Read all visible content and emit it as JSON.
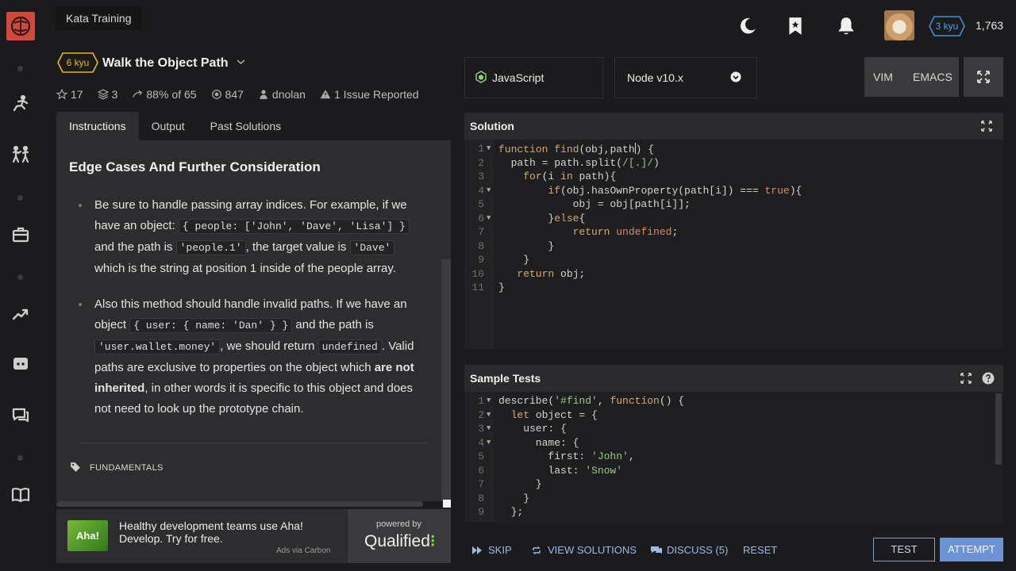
{
  "tooltip": "Kata Training",
  "user": {
    "rank": "3 kyu",
    "honor": "1,763"
  },
  "kata": {
    "rank": "6 kyu",
    "title": "Walk the Object Path",
    "stats": {
      "stars": "17",
      "collections": "3",
      "satisfaction_pct": "88%",
      "satisfaction_of": "of 65",
      "completed": "847",
      "author": "dnolan",
      "issues": "1 Issue Reported"
    }
  },
  "tabs": [
    "Instructions",
    "Output",
    "Past Solutions"
  ],
  "description": {
    "heading": "Edge Cases And Further Consideration",
    "bullet1": {
      "t1": "Be sure to handle passing array indices. For example, if we have an object:",
      "c1": "{ people: ['John', 'Dave', 'Lisa'] }",
      "t2": "and the path is",
      "c2": "'people.1'",
      "t3": ", the target value is",
      "c3": "'Dave'",
      "t4": "which is the string at position 1 inside of the people array."
    },
    "bullet2": {
      "t1": "Also this method should handle invalid paths. If we have an object",
      "c1": "{ user: { name: 'Dan' } }",
      "t2": "and the path is",
      "c2": "'user.wallet.money'",
      "t3": ", we should return",
      "c3": "undefined",
      "t4": ". Valid paths are exclusive to properties on the object which",
      "b1": "are not inherited",
      "t5": ", in other words it is specific to this object and does not need to look up the prototype chain."
    },
    "tag": "FUNDAMENTALS"
  },
  "ad": {
    "image_text": "Aha!",
    "text": "Healthy development teams use Aha! Develop. Try for free.",
    "via": "Ads via Carbon",
    "powered_by": "powered by",
    "brand": "Qualified"
  },
  "editor": {
    "language": "JavaScript",
    "version": "Node v10.x",
    "modes": [
      "VIM",
      "EMACS"
    ],
    "solution_title": "Solution",
    "solution_lines": [
      "function find(obj,path) {",
      "  path = path.split(/[.]/)",
      "    for(i in path){",
      "        if(obj.hasOwnProperty(path[i]) === true){",
      "            obj = obj[path[i]];",
      "        }else{",
      "            return undefined;",
      "        }",
      "    }",
      "   return obj;",
      "}"
    ],
    "tests_title": "Sample Tests",
    "test_lines": [
      "describe('#find', function() {",
      "  let object = {",
      "    user: {",
      "      name: {",
      "        first: 'John',",
      "        last: 'Snow'",
      "      }",
      "    }",
      "  };"
    ]
  },
  "actions": {
    "skip": "SKIP",
    "view_solutions": "VIEW SOLUTIONS",
    "discuss": "DISCUSS (5)",
    "reset": "RESET",
    "test": "TEST",
    "attempt": "ATTEMPT"
  }
}
